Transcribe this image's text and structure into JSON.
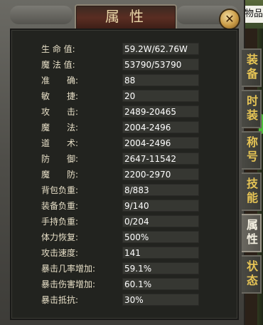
{
  "scene": {
    "side_text": "物品"
  },
  "window": {
    "title": "属性",
    "close_icon": "close-x-icon"
  },
  "stats": [
    {
      "label": "生 命 值:",
      "value": "59.2W/62.76W"
    },
    {
      "label": "魔 法 值:",
      "value": "53790/53790"
    },
    {
      "label": "准　　确:",
      "value": "88"
    },
    {
      "label": "敏　　捷:",
      "value": "20"
    },
    {
      "label": "攻　　击:",
      "value": "2489-20465"
    },
    {
      "label": "魔　　法:",
      "value": "2004-2496"
    },
    {
      "label": "道　　术:",
      "value": "2004-2496"
    },
    {
      "label": "防　　御:",
      "value": "2647-11542"
    },
    {
      "label": "魔　　防:",
      "value": "2200-2970"
    },
    {
      "label": "背包负重:",
      "value": "8/883"
    },
    {
      "label": "装备负重:",
      "value": "9/140"
    },
    {
      "label": "手持负重:",
      "value": "0/204"
    },
    {
      "label": "体力恢复:",
      "value": "500%"
    },
    {
      "label": "攻击速度:",
      "value": "141"
    },
    {
      "label": "暴击几率增加:",
      "value": "59.1%"
    },
    {
      "label": "暴击伤害增加:",
      "value": "60.1%"
    },
    {
      "label": "暴击抵抗:",
      "value": "30%"
    }
  ],
  "tabs": [
    {
      "label": "装备",
      "active": false
    },
    {
      "label": "时装",
      "active": false
    },
    {
      "label": "称号",
      "active": false
    },
    {
      "label": "技能",
      "active": false
    },
    {
      "label": "属性",
      "active": true
    },
    {
      "label": "状态",
      "active": false
    }
  ]
}
